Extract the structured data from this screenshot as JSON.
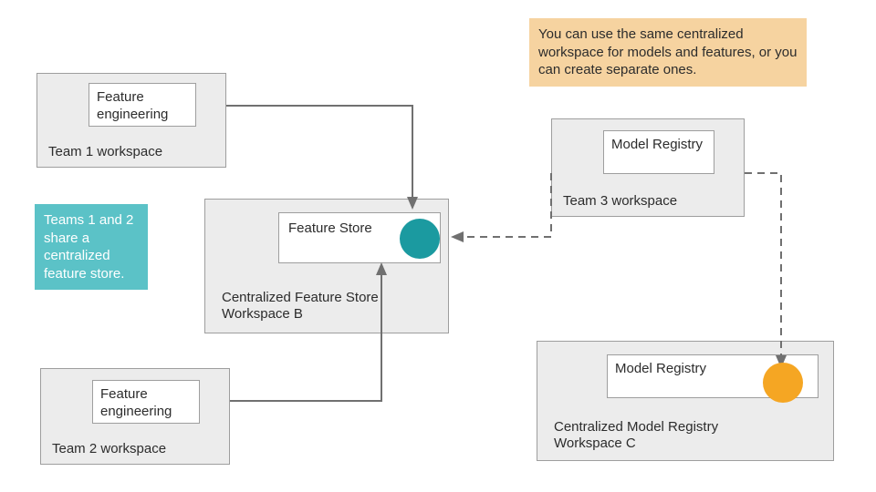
{
  "team1": {
    "label": "Team 1 workspace",
    "inner": "Feature engineering"
  },
  "team2": {
    "label": "Team 2 workspace",
    "inner": "Feature engineering"
  },
  "team3": {
    "label": "Team 3 workspace",
    "inner": "Model Registry"
  },
  "featureStore": {
    "label": "Centralized Feature Store Workspace B",
    "inner": "Feature Store"
  },
  "modelRegistry": {
    "label": "Centralized Model Registry Workspace C",
    "inner": "Model Registry"
  },
  "callouts": {
    "tealNote": "Teams 1 and 2 share a centralized feature store.",
    "orangeNote": "You can use the same centralized workspace for models and features, or you can create separate ones."
  },
  "colors": {
    "tealCircle": "#1b9aa0",
    "tealNoteBg": "#5bc2c7",
    "orangeCircle": "#f5a623",
    "orangeNoteBg": "#f6d3a0",
    "arrowStroke": "#707070"
  }
}
